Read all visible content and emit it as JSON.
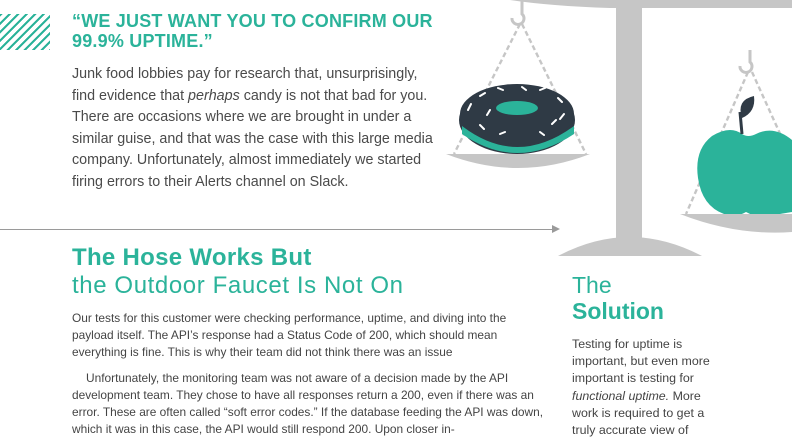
{
  "quote": {
    "title": "“WE JUST WANT YOU TO CONFIRM OUR 99.9% UPTIME.”",
    "intro_before": "Junk food lobbies pay for research that, unsurprisingly, find evidence that ",
    "intro_em": "perhaps",
    "intro_after": " candy is not that bad for you. There are occasions where we are brought in under a similar guise, and that was the case with this large media company. Unfortunately, almost immediately we started firing errors to their Alerts channel on Slack."
  },
  "section": {
    "title_line1": "The Hose Works But",
    "title_line2": "the Outdoor Faucet Is Not On",
    "para1": "Our tests for this customer were checking performance, uptime, and diving into the payload itself. The API’s response had a Status Code of 200, which should mean everything is fine. This is why their team did not think there was an issue",
    "para2": "Unfortunately, the monitoring team was not aware of a decision made by the API development team. They chose to have all responses return a 200, even if there was an error. These are often called “soft error codes.” If the database feeding the API was down, which it was in this case, the API would still respond 200. Upon closer in-"
  },
  "sidebar": {
    "title_line1": "The",
    "title_line2": "Solution",
    "text_before": "Testing for uptime is important, but even more important is testing for ",
    "text_em": "functional uptime.",
    "text_after": " More work is required to get a truly accurate view of"
  },
  "colors": {
    "accent": "#2bb39a",
    "scale_gray": "#c6c6c6",
    "donut_dark": "#2f3a45"
  },
  "icons": [
    "balance-scale-icon",
    "donut-icon",
    "apple-icon"
  ]
}
